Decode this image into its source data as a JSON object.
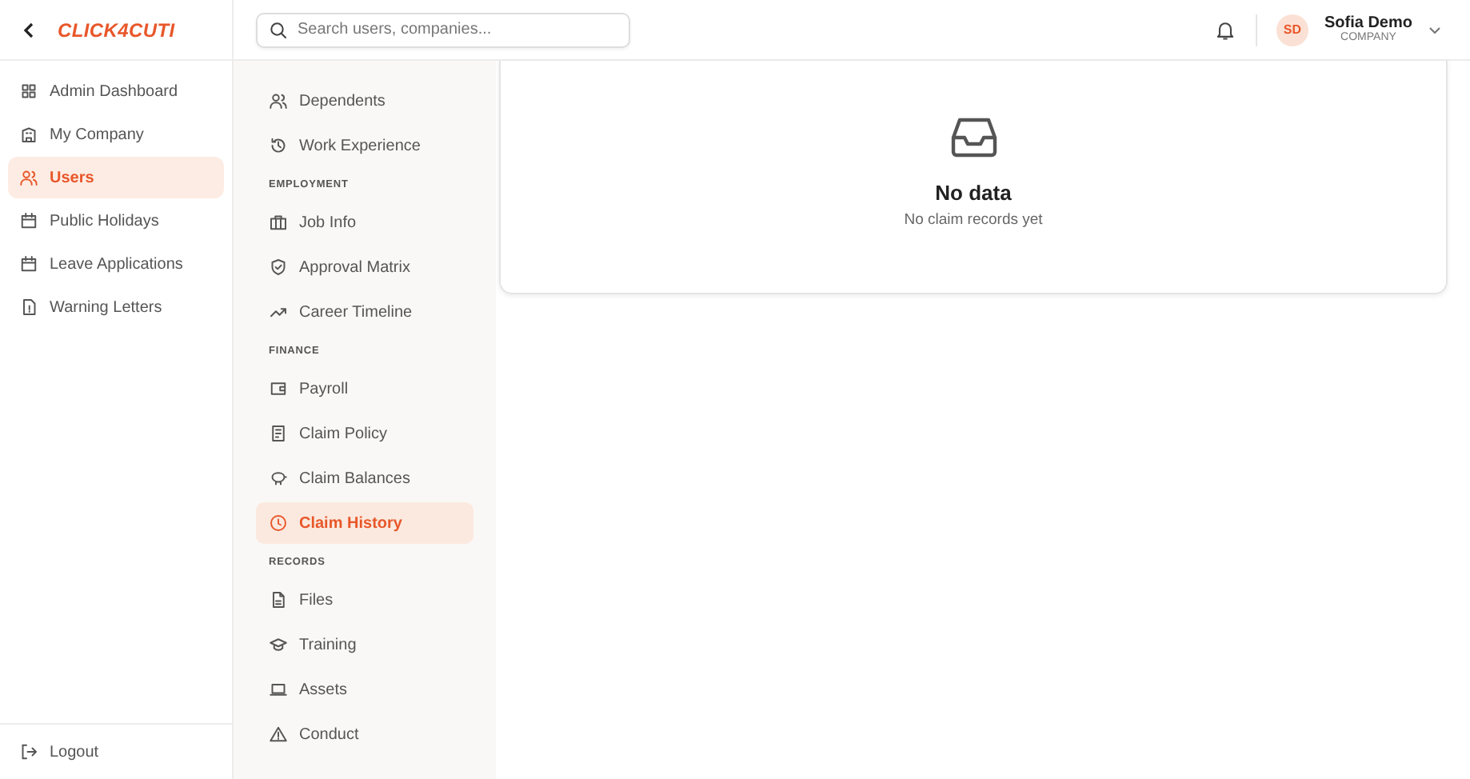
{
  "brand": {
    "logo": "CLICK4CUTI"
  },
  "sidebar": {
    "items": [
      {
        "label": "Admin Dashboard",
        "selected": false
      },
      {
        "label": "My Company",
        "selected": false
      },
      {
        "label": "Users",
        "selected": true
      },
      {
        "label": "Public Holidays",
        "selected": false
      },
      {
        "label": "Leave Applications",
        "selected": false
      },
      {
        "label": "Warning Letters",
        "selected": false
      }
    ],
    "logout": "Logout"
  },
  "header": {
    "search": {
      "placeholder": "Search users, companies..."
    },
    "user": {
      "initials": "SD",
      "name": "Sofia Demo",
      "role": "COMPANY"
    }
  },
  "subnav": {
    "sections": [
      {
        "items": [
          {
            "label": "Dependents",
            "selected": false
          },
          {
            "label": "Work Experience",
            "selected": false
          }
        ]
      },
      {
        "title": "EMPLOYMENT",
        "items": [
          {
            "label": "Job Info",
            "selected": false
          },
          {
            "label": "Approval Matrix",
            "selected": false
          },
          {
            "label": "Career Timeline",
            "selected": false
          }
        ]
      },
      {
        "title": "FINANCE",
        "items": [
          {
            "label": "Payroll",
            "selected": false
          },
          {
            "label": "Claim Policy",
            "selected": false
          },
          {
            "label": "Claim Balances",
            "selected": false
          },
          {
            "label": "Claim History",
            "selected": true
          }
        ]
      },
      {
        "title": "RECORDS",
        "items": [
          {
            "label": "Files",
            "selected": false
          },
          {
            "label": "Training",
            "selected": false
          },
          {
            "label": "Assets",
            "selected": false
          },
          {
            "label": "Conduct",
            "selected": false
          }
        ]
      }
    ]
  },
  "empty_state": {
    "title": "No data",
    "message": "No claim records yet"
  }
}
